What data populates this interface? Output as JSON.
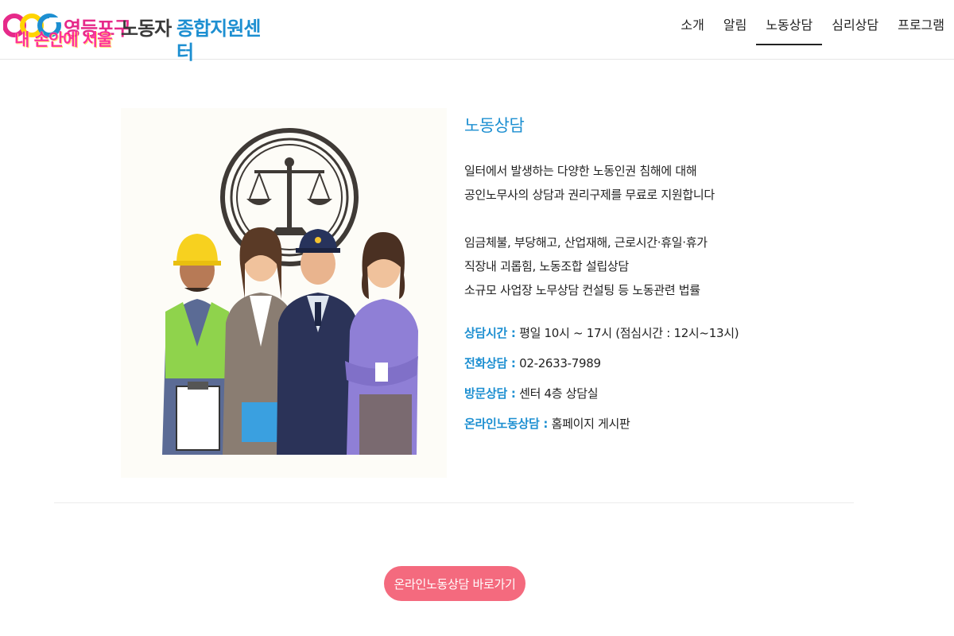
{
  "header": {
    "logo": {
      "gu": "영등포구",
      "labor": "노동자",
      "center": "종합지원센터",
      "slogan": "내 손안에 서울"
    },
    "nav": [
      {
        "label": "소개",
        "active": false
      },
      {
        "label": "알림",
        "active": false
      },
      {
        "label": "노동상담",
        "active": true
      },
      {
        "label": "심리상담",
        "active": false
      },
      {
        "label": "프로그램",
        "active": false
      }
    ]
  },
  "main": {
    "title": "노동상담",
    "intro_lines": [
      "일터에서 발생하는 다양한 노동인권 침해에 대해",
      "공인노무사의 상담과 권리구제를 무료로 지원합니다"
    ],
    "service_lines": [
      "임금체불, 부당해고, 산업재해, 근로시간·휴일·휴가",
      "직장내 괴롭힘, 노동조합 설립상담",
      "소규모 사업장 노무상담 컨설팅 등 노동관련 법률"
    ],
    "details": [
      {
        "label": "상담시간 :",
        "value": " 평일 10시 ~ 17시 (점심시간 : 12시~13시)"
      },
      {
        "label": "전화상담 :",
        "value": " 02-2633-7989"
      },
      {
        "label": "방문상담 :",
        "value": " 센터 4층 상담실"
      },
      {
        "label": "온라인노동상담 :",
        "value": " 홈페이지 게시판"
      }
    ],
    "cta_label": "온라인노동상담 바로가기"
  },
  "colors": {
    "accent_blue": "#1d8fd1",
    "brand_pink": "#e62a8a",
    "cta_pink": "#f46a7e"
  }
}
